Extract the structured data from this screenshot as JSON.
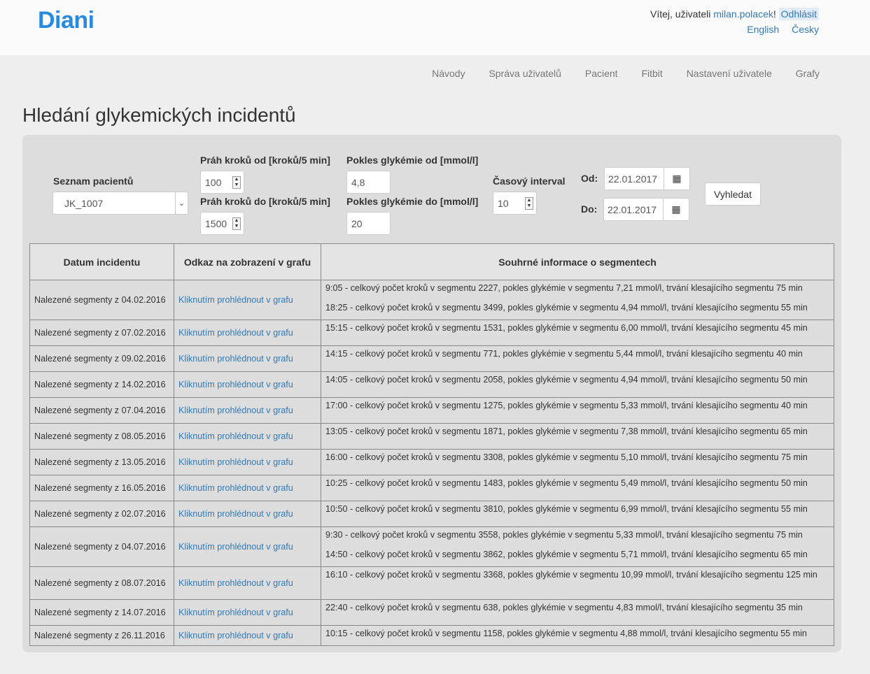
{
  "header": {
    "logo": "Diani",
    "welcome_prefix": "Vítej, uživateli ",
    "username": "milan.polacek",
    "welcome_suffix": "! ",
    "logout": "Odhlásit",
    "languages": [
      "English",
      "Česky"
    ]
  },
  "nav": [
    "Návody",
    "Správa uživatelů",
    "Pacient",
    "Fitbit",
    "Nastavení uživatele",
    "Grafy"
  ],
  "page_title": "Hledání glykemických incidentů",
  "form": {
    "patient_list_label": "Seznam pacientů",
    "patient_selected": "JK_1007",
    "steps_from_label": "Práh kroků od [kroků/5 min]",
    "steps_from_value": "100",
    "steps_to_label": "Práh kroků do [kroků/5 min]",
    "steps_to_value": "1500",
    "glyc_from_label": "Pokles glykémie od [mmol/l]",
    "glyc_from_value": "4,8",
    "glyc_to_label": "Pokles glykémie do [mmol/l]",
    "glyc_to_value": "20",
    "interval_label": "Časový interval",
    "interval_value": "10",
    "from_label": "Od:",
    "from_value": "22.01.2017",
    "to_label": "Do:",
    "to_value": "22.01.2017",
    "search_button": "Vyhledat"
  },
  "table": {
    "headers": [
      "Datum incidentu",
      "Odkaz na zobrazení v grafu",
      "Souhrné informace o segmentech"
    ],
    "link_text": "Kliknutím prohlédnout v grafu",
    "rows": [
      {
        "date": "Nalezené segmenty z 04.02.2016",
        "segments": [
          "9:05 - celkový počet kroků v segmentu 2227, pokles glykémie v segmentu 7,21 mmol/l, trvání klesajícího segmentu 75 min",
          "18:25 - celkový počet kroků v segmentu 3499, pokles glykémie v segmentu 4,94 mmol/l, trvání klesajícího segmentu 55 min"
        ]
      },
      {
        "date": "Nalezené segmenty z 07.02.2016",
        "segments": [
          "15:15 - celkový počet kroků v segmentu 1531, pokles glykémie v segmentu 6,00 mmol/l, trvání klesajícího segmentu 45 min"
        ]
      },
      {
        "date": "Nalezené segmenty z 09.02.2016",
        "segments": [
          "14:15 - celkový počet kroků v segmentu 771, pokles glykémie v segmentu 5,44 mmol/l, trvání klesajícího segmentu 40 min"
        ]
      },
      {
        "date": "Nalezené segmenty z 14.02.2016",
        "segments": [
          "14:05 - celkový počet kroků v segmentu 2058, pokles glykémie v segmentu 4,94 mmol/l, trvání klesajícího segmentu 50 min"
        ]
      },
      {
        "date": "Nalezené segmenty z 07.04.2016",
        "segments": [
          "17:00 - celkový počet kroků v segmentu 1275, pokles glykémie v segmentu 5,33 mmol/l, trvání klesajícího segmentu 40 min"
        ]
      },
      {
        "date": "Nalezené segmenty z 08.05.2016",
        "segments": [
          "13:05 - celkový počet kroků v segmentu 1871, pokles glykémie v segmentu 7,38 mmol/l, trvání klesajícího segmentu 65 min"
        ]
      },
      {
        "date": "Nalezené segmenty z 13.05.2016",
        "segments": [
          "16:00 - celkový počet kroků v segmentu 3308, pokles glykémie v segmentu 5,10 mmol/l, trvání klesajícího segmentu 75 min"
        ]
      },
      {
        "date": "Nalezené segmenty z 16.05.2016",
        "segments": [
          "10:25 - celkový počet kroků v segmentu 1483, pokles glykémie v segmentu 5,49 mmol/l, trvání klesajícího segmentu 50 min"
        ]
      },
      {
        "date": "Nalezené segmenty z 02.07.2016",
        "segments": [
          "10:50 - celkový počet kroků v segmentu 3810, pokles glykémie v segmentu 6,99 mmol/l, trvání klesajícího segmentu 55 min"
        ]
      },
      {
        "date": "Nalezené segmenty z 04.07.2016",
        "segments": [
          "9:30 - celkový počet kroků v segmentu 3558, pokles glykémie v segmentu 5,33 mmol/l, trvání klesajícího segmentu 75 min",
          "14:50 - celkový počet kroků v segmentu 3862, pokles glykémie v segmentu 5,71 mmol/l, trvání klesajícího segmentu 65 min"
        ]
      },
      {
        "date": "Nalezené segmenty z 08.07.2016",
        "segments": [
          "16:10 - celkový počet kroků v segmentu 3368, pokles glykémie v segmentu 10,99 mmol/l, trvání klesajícího segmentu 125 min"
        ]
      },
      {
        "date": "Nalezené segmenty z 14.07.2016",
        "segments": [
          "22:40 - celkový počet kroků v segmentu 638, pokles glykémie v segmentu 4,83 mmol/l, trvání klesajícího segmentu 35 min"
        ]
      },
      {
        "date": "Nalezené segmenty z 26.11.2016",
        "segments": [
          "10:15 - celkový počet kroků v segmentu 1158, pokles glykémie v segmentu 4,88 mmol/l, trvání klesajícího segmentu 55 min"
        ]
      }
    ]
  }
}
